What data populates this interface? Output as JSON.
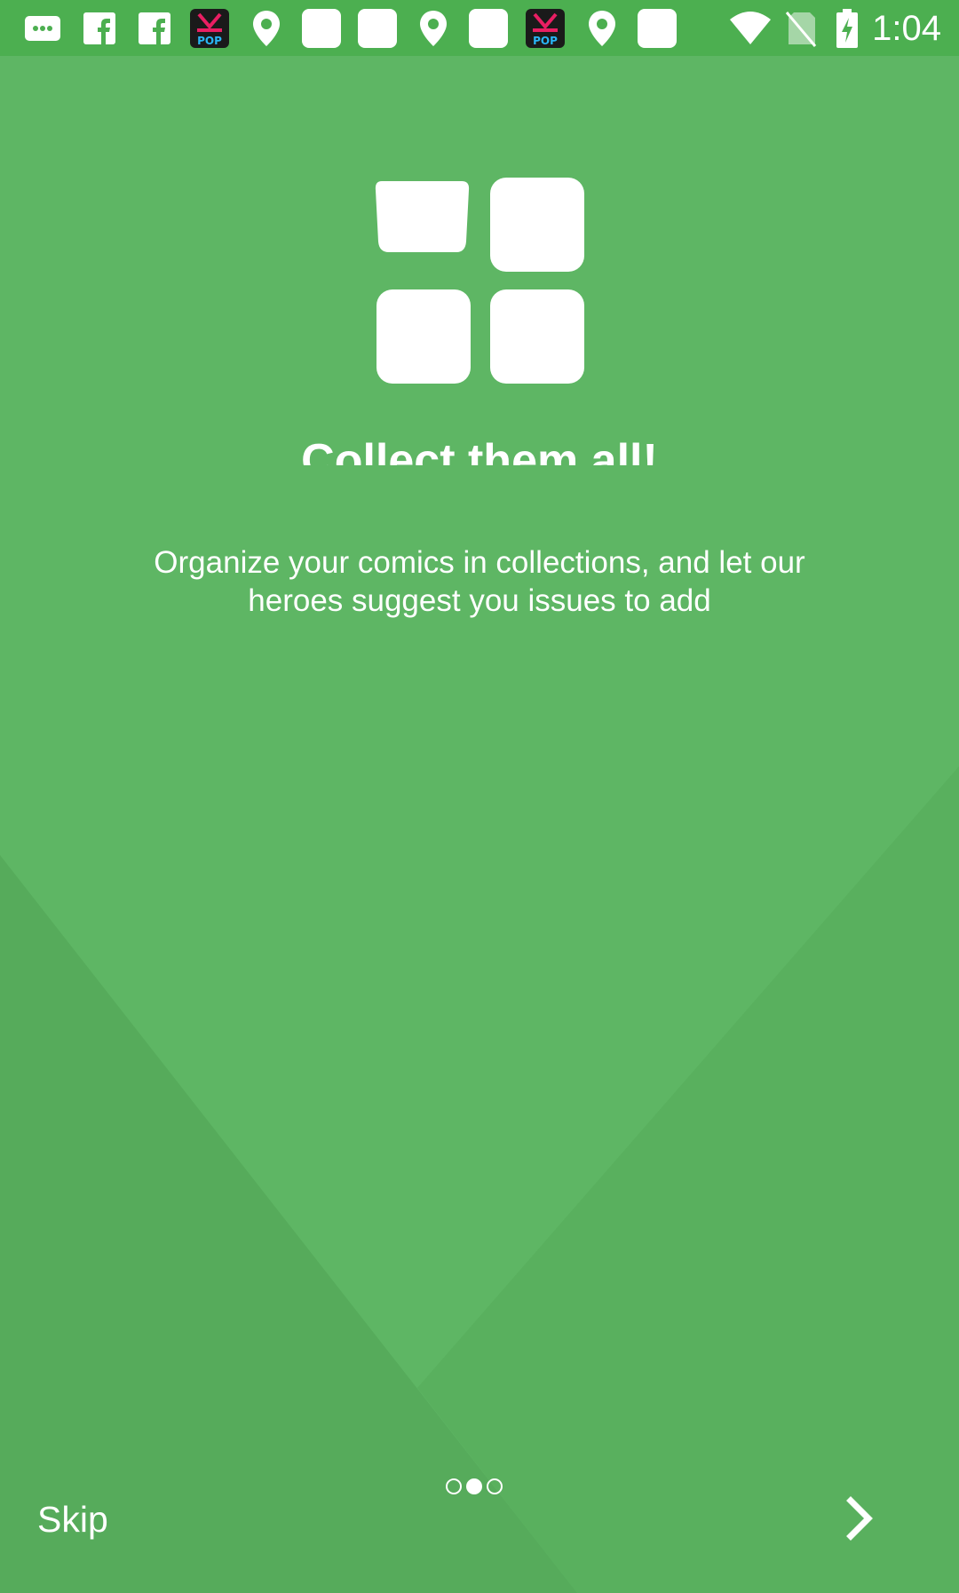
{
  "status_bar": {
    "time": "1:04",
    "notification_icons": [
      "message-icon",
      "facebook-icon",
      "facebook-icon",
      "kpop-icon",
      "location-pin-icon",
      "blank-notification-icon",
      "blank-notification-icon",
      "location-pin-icon",
      "blank-notification-icon",
      "kpop-icon",
      "location-pin-icon",
      "blank-notification-icon"
    ],
    "system_icons": [
      "wifi-icon",
      "no-sim-icon",
      "battery-charging-icon"
    ]
  },
  "onboarding": {
    "icon": "collections-grid-icon",
    "title": "Collect them all!",
    "description": "Organize your comics in collections, and let our heroes suggest you issues to add",
    "skip_label": "Skip",
    "next_icon": "chevron-right-icon",
    "page_indicator": {
      "total": 3,
      "current": 2
    }
  },
  "colors": {
    "background": "#5eb664",
    "status_bar": "#4caf50",
    "wedge_dark": "#55aa5a",
    "foreground": "#ffffff"
  }
}
